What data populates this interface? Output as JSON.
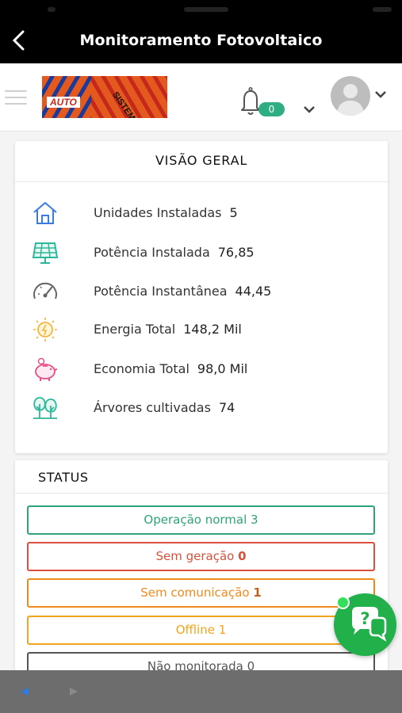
{
  "titlebar": {
    "title": "Monitoramento Fotovoltaico"
  },
  "header": {
    "logo_text_auto": "AUTO",
    "logo_text_sistemas": "SISTEMAS",
    "notification_count": "0"
  },
  "overview": {
    "title": "VISÃO GERAL",
    "items": [
      {
        "icon": "house-icon",
        "label": "Unidades Instaladas",
        "value": "5"
      },
      {
        "icon": "solar-panel-icon",
        "label": "Potência Instalada",
        "value": "76,85"
      },
      {
        "icon": "gauge-icon",
        "label": "Potência Instantânea",
        "value": "44,45"
      },
      {
        "icon": "sun-energy-icon",
        "label": "Energia Total",
        "value": "148,2 Mil"
      },
      {
        "icon": "piggy-bank-icon",
        "label": "Economia Total",
        "value": "98,0 Mil"
      },
      {
        "icon": "trees-icon",
        "label": "Árvores cultivadas",
        "value": "74"
      }
    ]
  },
  "status": {
    "title": "STATUS",
    "items": [
      {
        "label": "Operação normal",
        "count": "3",
        "color": "#2ea37a"
      },
      {
        "label": "Sem geração",
        "count": "0",
        "color": "#d9513c"
      },
      {
        "label": "Sem comunicação",
        "count": "1",
        "color": "#f08a1c"
      },
      {
        "label": "Offline",
        "count": "1",
        "color": "#f2a51c"
      },
      {
        "label": "Não monitorada",
        "count": "0",
        "color": "#555555"
      }
    ]
  },
  "colors": {
    "accent": "#2fae82",
    "help": "#22b04b",
    "topbar": "#000000"
  }
}
